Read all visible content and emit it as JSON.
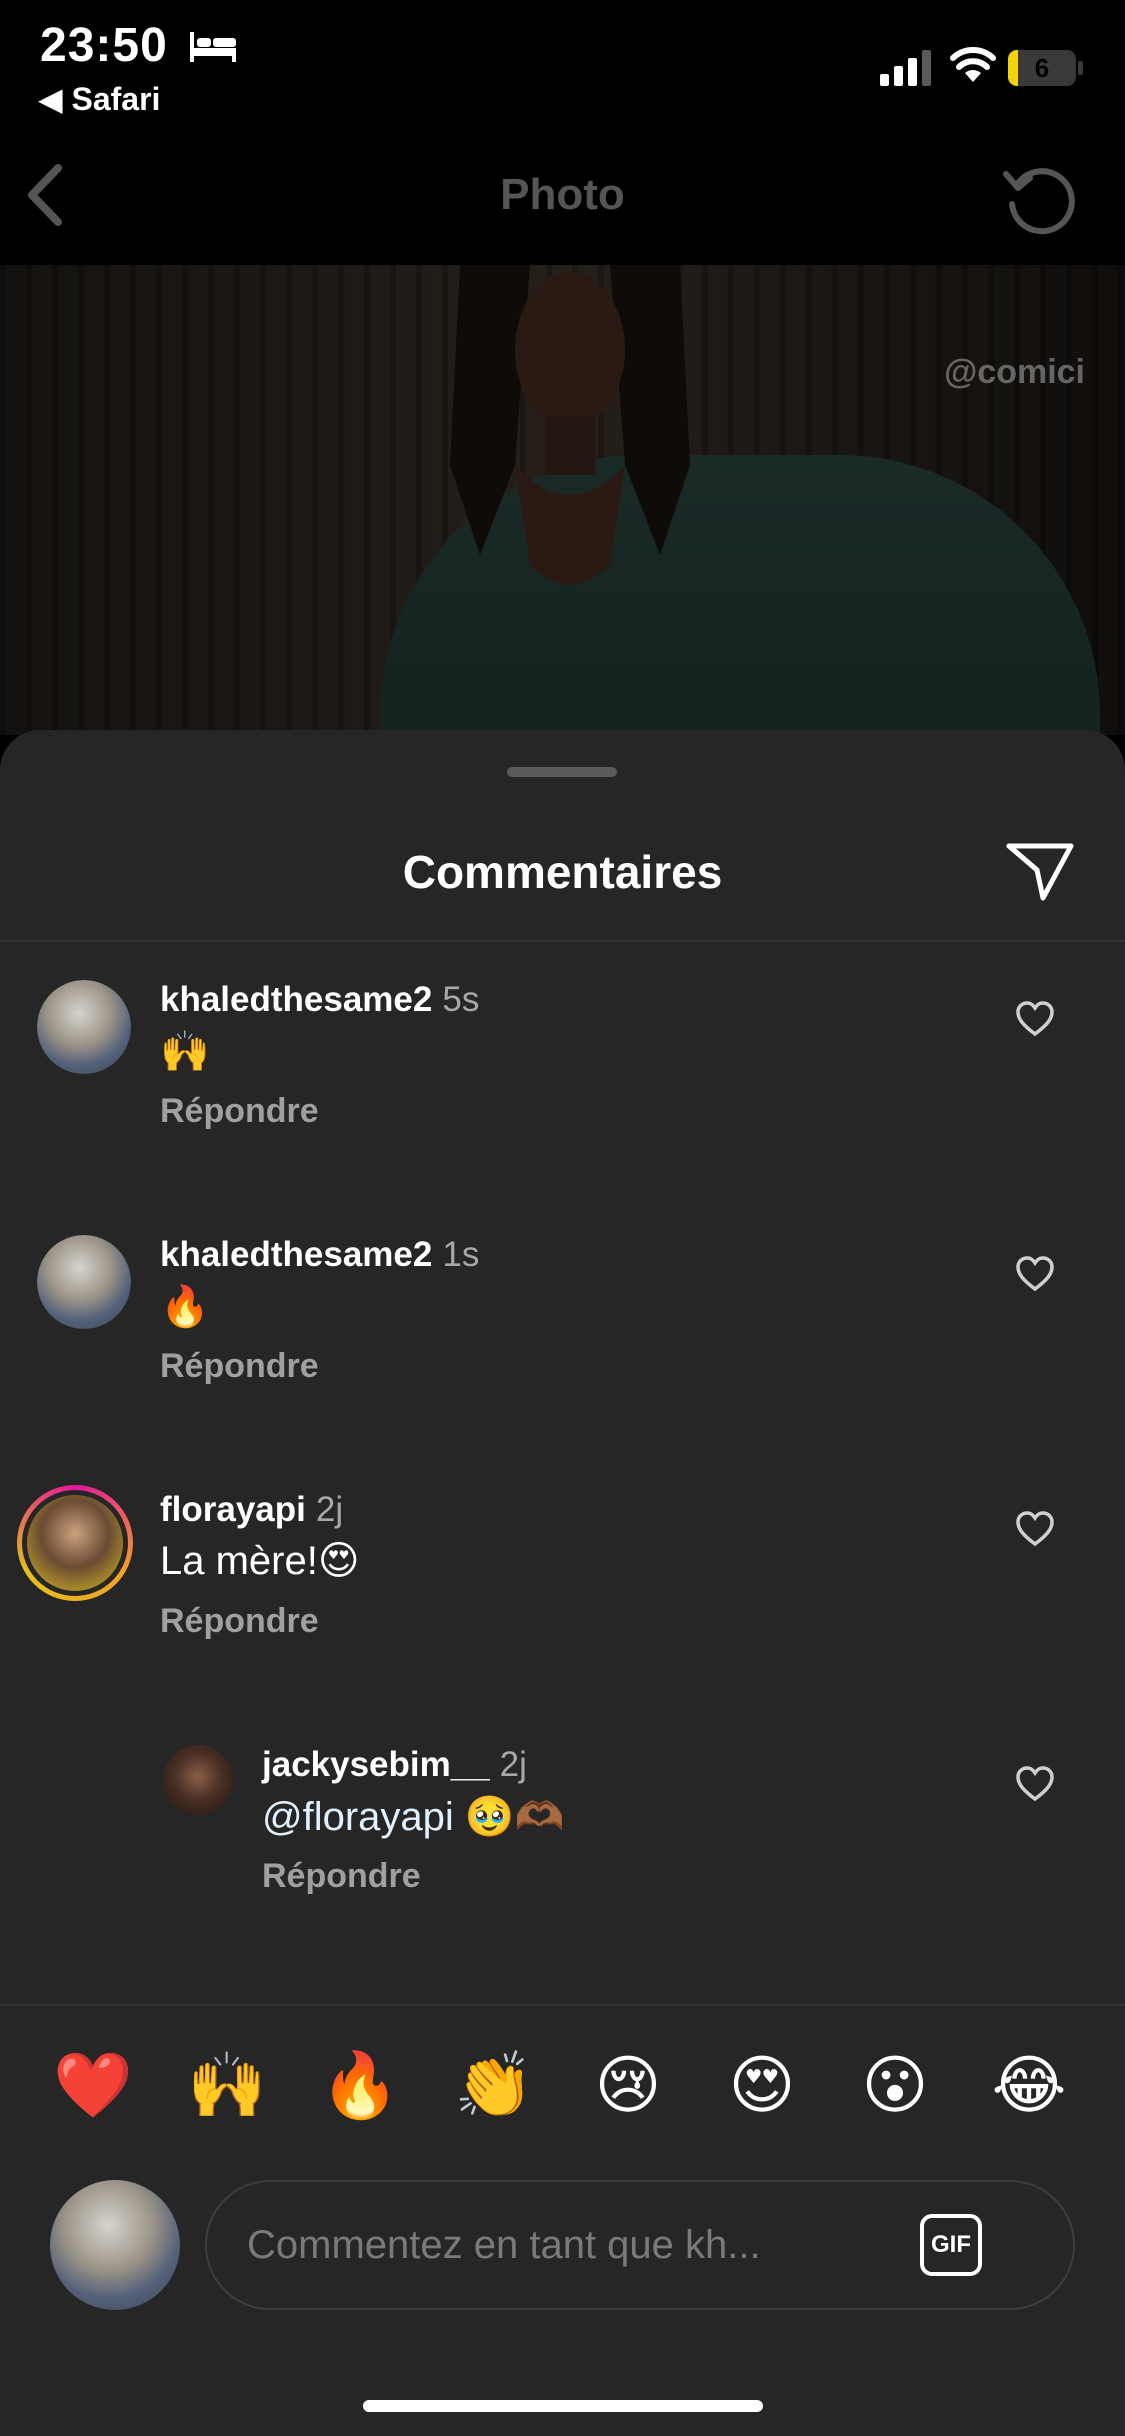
{
  "status_bar": {
    "time": "23:50",
    "back_app": "◀ Safari",
    "battery_level": "6",
    "bed_icon": "bed-icon",
    "signal_icon": "signal-icon",
    "wifi_icon": "wifi-icon"
  },
  "nav": {
    "title": "Photo",
    "back_icon": "chevron-left-icon",
    "refresh_icon": "refresh-icon"
  },
  "photo": {
    "watermark": "@comici"
  },
  "sheet": {
    "title": "Commentaires",
    "send_icon": "send-icon"
  },
  "comments": [
    {
      "username": "khaledthesame2",
      "time": "5s",
      "text": "🙌",
      "reply_label": "Répondre"
    },
    {
      "username": "khaledthesame2",
      "time": "1s",
      "text": "🔥",
      "reply_label": "Répondre"
    },
    {
      "username": "florayapi",
      "time": "2j",
      "text": "La mère!😍",
      "reply_label": "Répondre"
    },
    {
      "username": "jackysebim__",
      "time": "2j",
      "mention": "@florayapi",
      "text": " 🥹🫶🏾",
      "reply_label": "Répondre"
    }
  ],
  "quick_emojis": [
    "❤️",
    "🙌",
    "🔥",
    "👏",
    "😢",
    "😍",
    "😮",
    "😂"
  ],
  "composer": {
    "placeholder": "Commentez en tant que kh...",
    "gif_label": "GIF"
  },
  "colors": {
    "sheet_bg": "#262626",
    "muted_text": "#a8a8a8",
    "story_ring": "#e3169a"
  }
}
